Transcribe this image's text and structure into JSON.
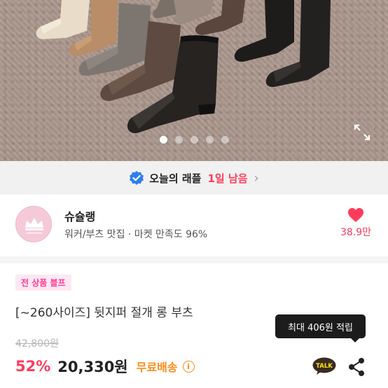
{
  "gallery": {
    "image_count": 5,
    "active_index": 0,
    "expand_icon": "expand-icon"
  },
  "raffle": {
    "label": "오늘의 래플",
    "count": "1일 남음",
    "icon": "verified-check-icon"
  },
  "seller": {
    "name": "슈슐랭",
    "description": "워커/부츠 맛집 · 마켓 만족도 96%",
    "likes": "38.9만",
    "like_icon": "heart-icon"
  },
  "product": {
    "tag": "전 상품 블프",
    "title": "[~260사이즈] 뒷지퍼 절개 롱 부츠",
    "original_price": "42,800원",
    "discount": "52%",
    "price": "20,330원",
    "shipping": "무료배송"
  },
  "actions": {
    "tooltip": "최대 406원 적립",
    "talk_label": "TALK"
  },
  "colors": {
    "accent": "#ff3b5c",
    "shipping": "#ff8c19",
    "tag_text": "#ff3d96",
    "tag_bg": "#fde8f3"
  }
}
